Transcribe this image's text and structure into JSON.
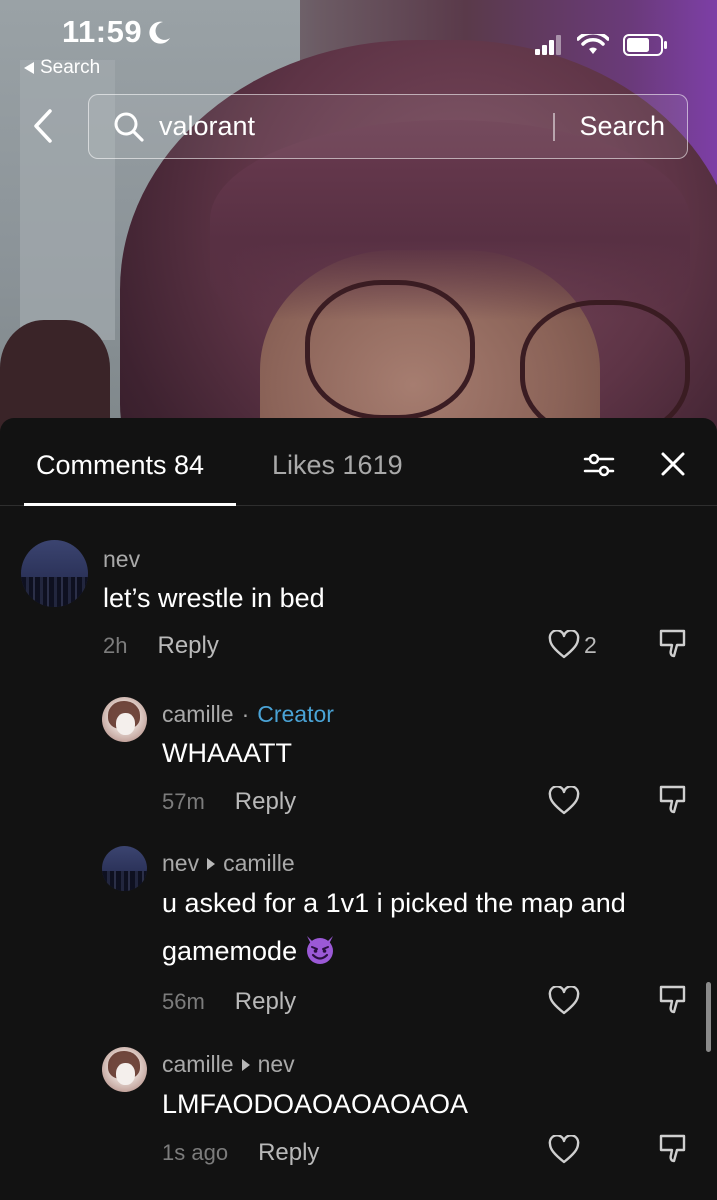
{
  "status_bar": {
    "time": "11:59",
    "back_app_label": "Search",
    "icons": [
      "moon-icon",
      "cellular-icon",
      "wifi-icon",
      "battery-icon"
    ]
  },
  "header": {
    "query": "valorant",
    "search_button": "Search"
  },
  "tabs": {
    "comments": "Comments 84",
    "likes": "Likes 1619"
  },
  "colors": {
    "background": "#121212",
    "creator_badge": "#4aa3d6",
    "secondary_text": "#a9a9a9",
    "emoji_purple": "#9b59d6"
  },
  "comments": [
    {
      "user": "nev",
      "text": "let’s wrestle in bed",
      "time": "2h",
      "reply_label": "Reply",
      "likes": "2"
    },
    {
      "user": "camille",
      "separator": "·",
      "badge": "Creator",
      "text": "WHAAATT",
      "time": "57m",
      "reply_label": "Reply"
    },
    {
      "user": "nev",
      "reply_to": "camille",
      "text_line1": "u asked for a 1v1 i picked the map and",
      "text_line2": "gamemode",
      "emoji": "smiling-devil-emoji",
      "time": "56m",
      "reply_label": "Reply"
    },
    {
      "user": "camille",
      "reply_to": "nev",
      "text": "LMFAODOAOAOAOAOA",
      "time": "1s ago",
      "reply_label": "Reply"
    }
  ]
}
